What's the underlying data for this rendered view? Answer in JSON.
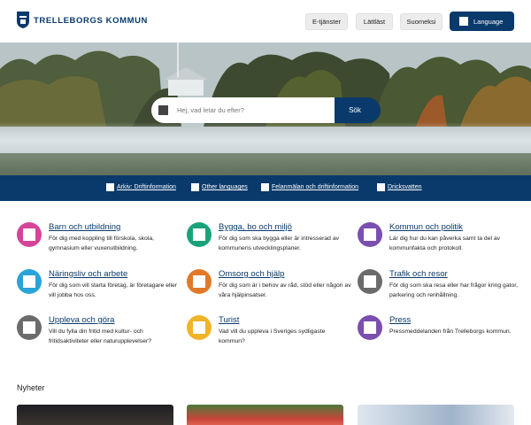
{
  "header": {
    "logo_text": "TRELLEBORGS KOMMUN",
    "buttons": [
      "E-tjänster",
      "Lättläst",
      "Suomeksi"
    ],
    "language_label": "Language"
  },
  "search": {
    "placeholder": "Hej, vad letar du efter?",
    "button_label": "Sök"
  },
  "quicklinks": [
    "Arkiv: Driftinformation",
    "Other languages",
    "Felanmälan och driftinformation",
    "Dricksvatten"
  ],
  "categories": [
    {
      "title": "Barn och utbildning",
      "desc": "För dig med koppling till förskola, skola, gymnasium eller vuxenutbildning.",
      "color": "#d6449a"
    },
    {
      "title": "Bygga, bo och miljö",
      "desc": "För dig som ska bygga eller är intresserad av kommunens utvecklingsplaner.",
      "color": "#1aa37a"
    },
    {
      "title": "Kommun och politik",
      "desc": "Lär dig hur du kan påverka samt ta del av kommunfakta och protokoll.",
      "color": "#7a4fb0"
    },
    {
      "title": "Näringsliv och arbete",
      "desc": "För dig som vill starta företag, är företagare eller vill jobba hos oss.",
      "color": "#2aa3d8"
    },
    {
      "title": "Omsorg och hjälp",
      "desc": "För dig som är i behov av råd, stöd eller någon av våra hjälpinsatser.",
      "color": "#e07a2a"
    },
    {
      "title": "Trafik och resor",
      "desc": "För dig som ska resa eller har frågor kring gator, parkering och renhållning.",
      "color": "#6b6b6b"
    },
    {
      "title": "Uppleva och göra",
      "desc": "Vill du fylla din fritid med kultur- och fritidsaktiviteter eller naturupplevelser?",
      "color": "#6b6b6b"
    },
    {
      "title": "Turist",
      "desc": "Vad vill du uppleva i Sveriges sydligaste kommun?",
      "color": "#f0b429"
    },
    {
      "title": "Press",
      "desc": "Pressmeddelanden från Trelleborgs kommun.",
      "color": "#7a4fb0"
    }
  ],
  "news": {
    "heading": "Nyheter"
  }
}
